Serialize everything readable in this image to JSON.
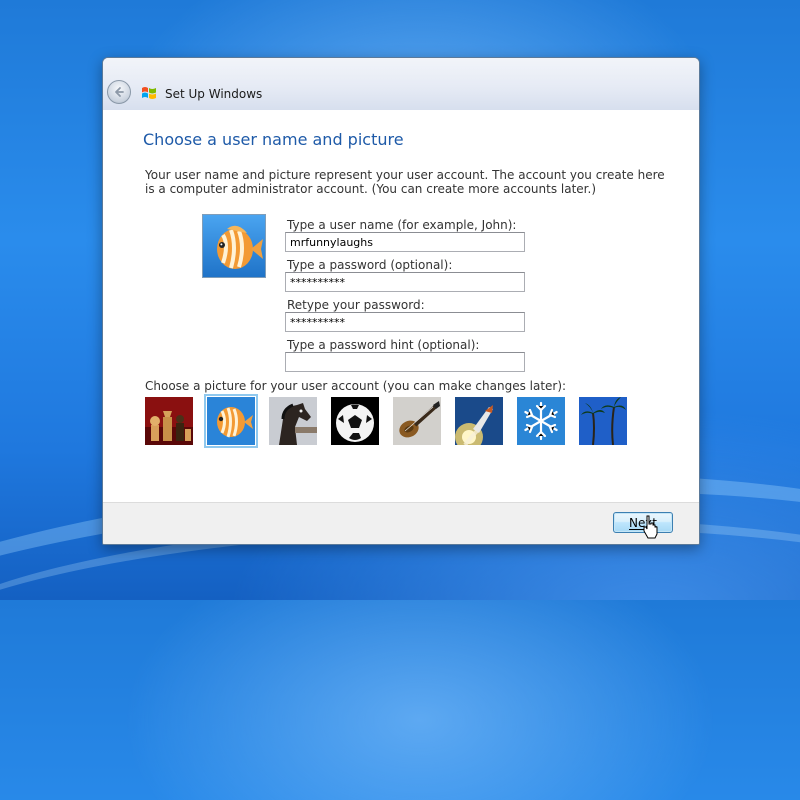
{
  "window": {
    "title": "Set Up Windows"
  },
  "page": {
    "heading": "Choose a user name and picture",
    "intro": "Your user name and picture represent your user account. The account you create here is a computer administrator account. (You can create more accounts later.)"
  },
  "form": {
    "username_label": "Type a user name (for example, John):",
    "username_value": "mrfunnylaughs",
    "password_label": "Type a password (optional):",
    "password_value": "**********",
    "retype_label": "Retype your password:",
    "retype_value": "**********",
    "hint_label": "Type a password hint (optional):",
    "hint_value": ""
  },
  "pictures": {
    "label": "Choose a picture for your user account (you can make changes later):",
    "items": [
      "chess",
      "fish",
      "horse",
      "soccer-ball",
      "guitar",
      "space-shuttle",
      "snowflake",
      "palm-trees"
    ],
    "selected": "fish"
  },
  "footer": {
    "next_label": "Next"
  },
  "colors": {
    "heading": "#1e5aa8",
    "desktop": "#2a8cec"
  }
}
